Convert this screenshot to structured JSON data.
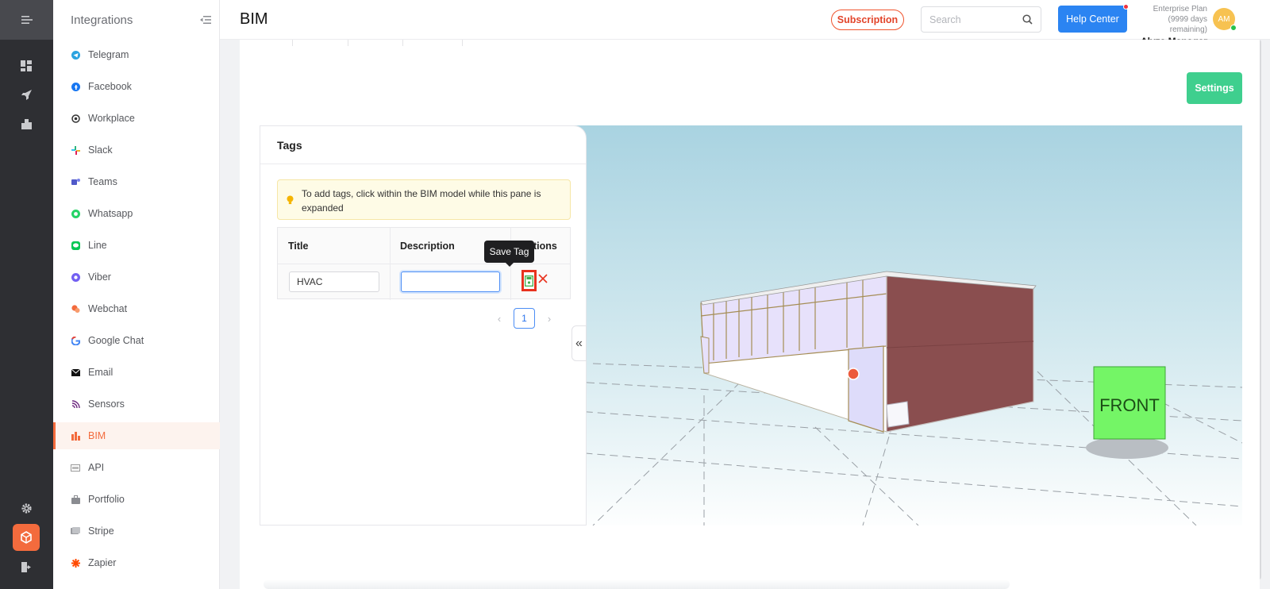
{
  "header": {
    "page_title": "BIM",
    "subscription_label": "Subscription",
    "search_placeholder": "Search",
    "help_center_label": "Help Center",
    "plan_name": "Enterprise Plan",
    "plan_remaining": "(9999 days remaining)",
    "user_name": "Alyza Manager",
    "avatar_initials": "AM"
  },
  "sidebar": {
    "title": "Integrations",
    "items": [
      {
        "label": "Telegram",
        "icon": "telegram-icon"
      },
      {
        "label": "Facebook",
        "icon": "facebook-icon"
      },
      {
        "label": "Workplace",
        "icon": "workplace-icon"
      },
      {
        "label": "Slack",
        "icon": "slack-icon"
      },
      {
        "label": "Teams",
        "icon": "teams-icon"
      },
      {
        "label": "Whatsapp",
        "icon": "whatsapp-icon"
      },
      {
        "label": "Line",
        "icon": "line-icon"
      },
      {
        "label": "Viber",
        "icon": "viber-icon"
      },
      {
        "label": "Webchat",
        "icon": "webchat-icon"
      },
      {
        "label": "Google Chat",
        "icon": "google-chat-icon"
      },
      {
        "label": "Email",
        "icon": "email-icon"
      },
      {
        "label": "Sensors",
        "icon": "sensors-icon"
      },
      {
        "label": "BIM",
        "icon": "bim-icon",
        "active": true
      },
      {
        "label": "API",
        "icon": "api-icon"
      },
      {
        "label": "Portfolio",
        "icon": "portfolio-icon"
      },
      {
        "label": "Stripe",
        "icon": "stripe-icon"
      },
      {
        "label": "Zapier",
        "icon": "zapier-icon"
      }
    ]
  },
  "main": {
    "settings_label": "Settings",
    "tags": {
      "title": "Tags",
      "info_text": "To add tags, click within the BIM model while this pane is expanded",
      "columns": [
        "Title",
        "Description",
        "Actions"
      ],
      "row": {
        "title_value": "HVAC",
        "description_value": ""
      },
      "tooltip": "Save Tag",
      "current_page": "1"
    },
    "viewer": {
      "cube_label": "FRONT"
    }
  },
  "colors": {
    "accent": "#f36b3d",
    "primary": "#2b84f2",
    "success": "#3fcf8e",
    "rail_bg": "#2e2f33"
  }
}
